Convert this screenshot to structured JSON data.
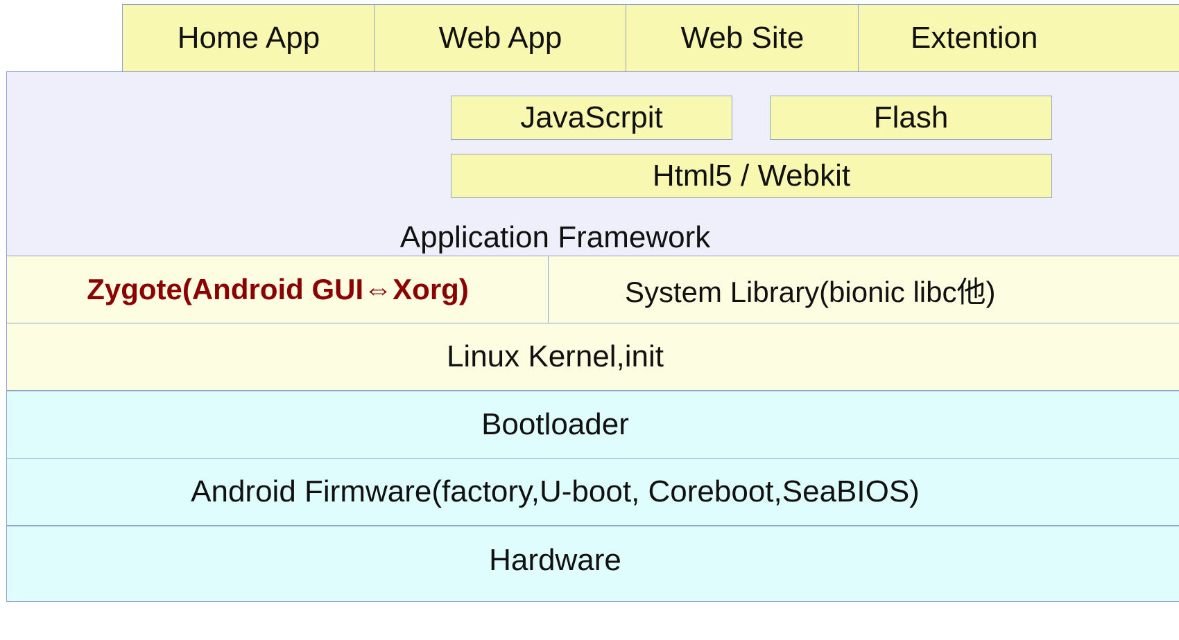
{
  "top_apps": [
    "Home App",
    "Web App",
    "Web Site",
    "Extention"
  ],
  "framework": {
    "javascript": "JavaScrpit",
    "flash": "Flash",
    "webkit": "Html5 / Webkit",
    "label": "Application Framework"
  },
  "middle": {
    "zygote": "Zygote(Android GUI⇔Xorg)",
    "system_library": "System Library(bionic libc他)"
  },
  "layers": {
    "kernel": "Linux Kernel,init",
    "bootloader": "Bootloader",
    "firmware": "Android Firmware(factory,U-boot, Coreboot,SeaBIOS)",
    "hardware": "Hardware"
  },
  "colors": {
    "app_box": "#f8f8b0",
    "framework_bg": "#eeeffa",
    "cream_layer": "#fdfde2",
    "cyan_layer": "#e0fdfd",
    "border": "#8fa4cc",
    "zygote_text": "#8b0000"
  }
}
